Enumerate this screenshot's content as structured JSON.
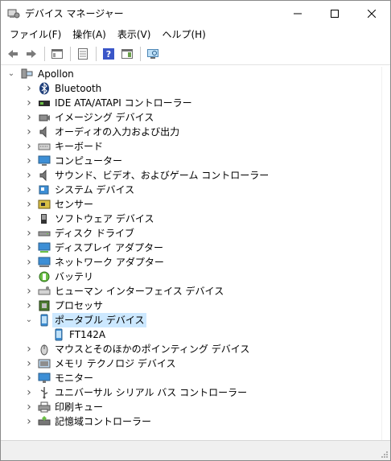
{
  "window": {
    "title": "デバイス マネージャー"
  },
  "menu": [
    "ファイル(F)",
    "操作(A)",
    "表示(V)",
    "ヘルプ(H)"
  ],
  "tree": {
    "root": "Apollon",
    "categories": [
      {
        "label": "Bluetooth",
        "icon": "bluetooth-icon"
      },
      {
        "label": "IDE ATA/ATAPI コントローラー",
        "icon": "ide-controller-icon"
      },
      {
        "label": "イメージング デバイス",
        "icon": "camera-icon"
      },
      {
        "label": "オーディオの入力および出力",
        "icon": "speaker-icon"
      },
      {
        "label": "キーボード",
        "icon": "keyboard-icon"
      },
      {
        "label": "コンピューター",
        "icon": "computer-icon"
      },
      {
        "label": "サウンド、ビデオ、およびゲーム コントローラー",
        "icon": "speaker-icon"
      },
      {
        "label": "システム デバイス",
        "icon": "system-device-icon"
      },
      {
        "label": "センサー",
        "icon": "sensor-icon"
      },
      {
        "label": "ソフトウェア デバイス",
        "icon": "software-device-icon"
      },
      {
        "label": "ディスク ドライブ",
        "icon": "disk-drive-icon"
      },
      {
        "label": "ディスプレイ アダプター",
        "icon": "display-adapter-icon"
      },
      {
        "label": "ネットワーク アダプター",
        "icon": "network-adapter-icon"
      },
      {
        "label": "バッテリ",
        "icon": "battery-icon"
      },
      {
        "label": "ヒューマン インターフェイス デバイス",
        "icon": "hid-icon"
      },
      {
        "label": "プロセッサ",
        "icon": "processor-icon"
      },
      {
        "label": "ポータブル デバイス",
        "icon": "portable-device-icon"
      },
      {
        "label": "FT142A",
        "icon": "portable-device-icon"
      },
      {
        "label": "マウスとそのほかのポインティング デバイス",
        "icon": "mouse-icon"
      },
      {
        "label": "メモリ テクノロジ デバイス",
        "icon": "memory-icon"
      },
      {
        "label": "モニター",
        "icon": "monitor-icon"
      },
      {
        "label": "ユニバーサル シリアル バス コントローラー",
        "icon": "usb-icon"
      },
      {
        "label": "印刷キュー",
        "icon": "printer-icon"
      },
      {
        "label": "記憶域コントローラー",
        "icon": "storage-controller-icon"
      }
    ]
  }
}
